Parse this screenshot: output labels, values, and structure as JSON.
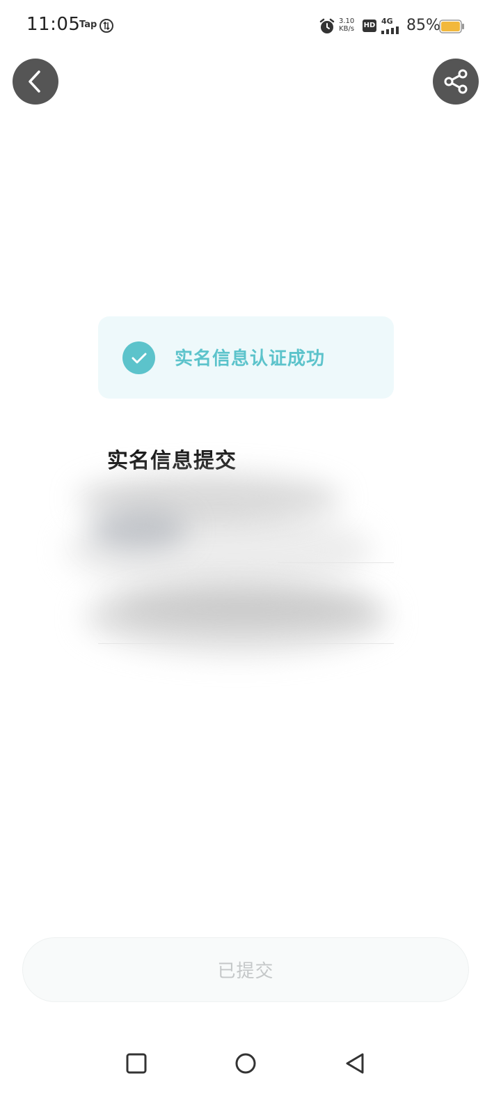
{
  "status_bar": {
    "time": "11:05",
    "tap_label": "Tap",
    "net_speed_value": "3.10",
    "net_speed_unit": "KB/s",
    "hd_label": "HD",
    "network_type": "4G",
    "battery_percent": "85%",
    "battery_level": 0.85,
    "battery_color": "#f2b83c"
  },
  "header": {
    "back_icon": "chevron-left-icon",
    "share_icon": "share-icon"
  },
  "success_banner": {
    "icon": "check-circle-icon",
    "text": "实名信息认证成功",
    "accent_color": "#5cc3cb"
  },
  "section": {
    "title": "实名信息提交"
  },
  "footer": {
    "submit_label": "已提交"
  },
  "nav_bar": {
    "recent_icon": "square-icon",
    "home_icon": "circle-icon",
    "back_icon": "triangle-back-icon"
  }
}
